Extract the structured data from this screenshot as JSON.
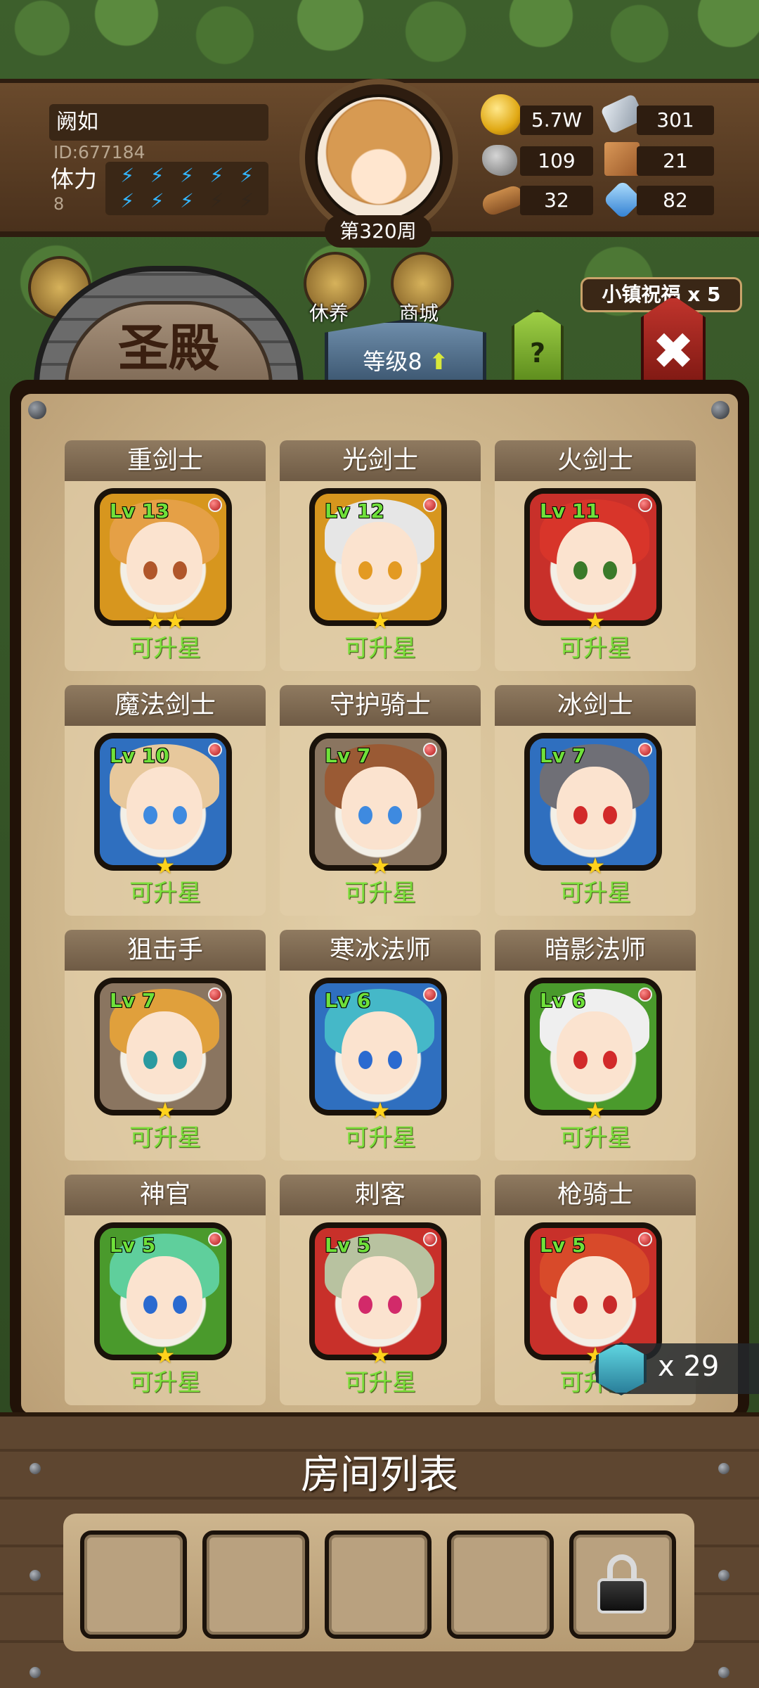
{
  "player": {
    "name": "阙如",
    "id": "ID:677184",
    "stamina_label": "体力",
    "stamina_count": "8",
    "stamina_bolts_full": 8,
    "stamina_bolts_total": 10,
    "week": "第320周"
  },
  "resources": {
    "gold": "5.7W",
    "iron": "301",
    "stone": "109",
    "map": "21",
    "wood": "32",
    "crystal": "82"
  },
  "menu": {
    "rest": "休养",
    "shop": "商城",
    "blessing": "小镇祝福 x 5"
  },
  "screen": {
    "title": "圣殿",
    "level": "等级8",
    "help": "?",
    "close": "✖"
  },
  "heroes": [
    {
      "name": "重剑士",
      "lv": "Lv 13",
      "stars": "★★",
      "status": "可升星"
    },
    {
      "name": "光剑士",
      "lv": "Lv 12",
      "stars": "★",
      "status": "可升星"
    },
    {
      "name": "火剑士",
      "lv": "Lv 11",
      "stars": "★",
      "status": "可升星"
    },
    {
      "name": "魔法剑士",
      "lv": "Lv 10",
      "stars": "★",
      "status": "可升星"
    },
    {
      "name": "守护骑士",
      "lv": "Lv 7",
      "stars": "★",
      "status": "可升星"
    },
    {
      "name": "冰剑士",
      "lv": "Lv 7",
      "stars": "★",
      "status": "可升星"
    },
    {
      "name": "狙击手",
      "lv": "Lv 7",
      "stars": "★",
      "status": "可升星"
    },
    {
      "name": "寒冰法师",
      "lv": "Lv 6",
      "stars": "★",
      "status": "可升星"
    },
    {
      "name": "暗影法师",
      "lv": "Lv 6",
      "stars": "★",
      "status": "可升星"
    },
    {
      "name": "神官",
      "lv": "Lv 5",
      "stars": "★",
      "status": "可升星"
    },
    {
      "name": "刺客",
      "lv": "Lv 5",
      "stars": "★",
      "status": "可升星"
    },
    {
      "name": "枪骑士",
      "lv": "Lv 5",
      "stars": "★",
      "status": "可升星"
    }
  ],
  "token": {
    "count": "x 29"
  },
  "rooms": {
    "title": "房间列表",
    "slot_count": 5,
    "locked_slot": 5
  }
}
